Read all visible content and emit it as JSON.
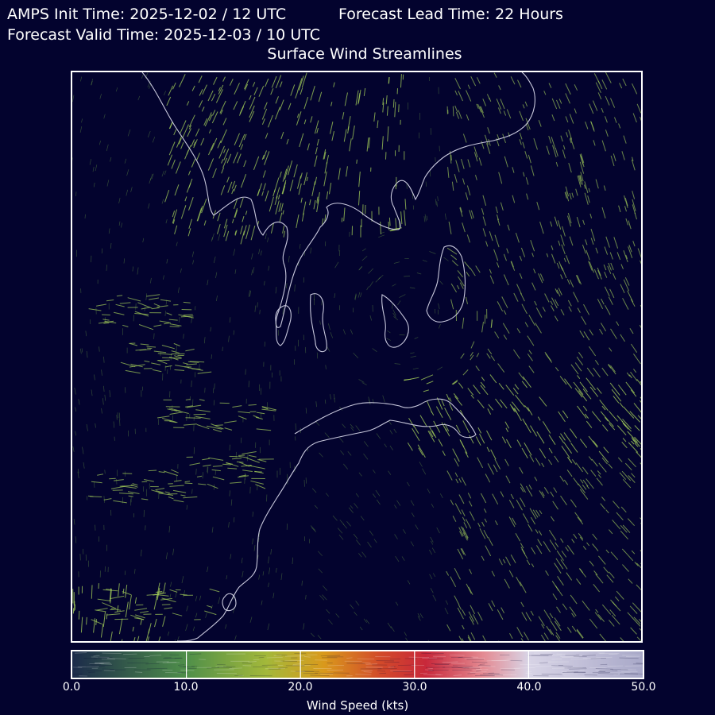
{
  "header": {
    "init_time": "AMPS Init Time: 2025-12-02 / 12 UTC",
    "lead_time": "Forecast Lead Time: 22 Hours",
    "valid_time": "Forecast Valid Time: 2025-12-03 / 10 UTC",
    "subtitle": "Surface Wind Streamlines"
  },
  "colors": {
    "background": "#03032e",
    "coastline": "#c8c8dc",
    "frame": "#ffffff",
    "streamline_low": "#7dbd4a",
    "streamline_high": "#a6d25a"
  },
  "colorbar": {
    "label": "Wind Speed (kts)",
    "min": 0,
    "max": 50,
    "ticks": [
      "0.0",
      "10.0",
      "20.0",
      "30.0",
      "40.0",
      "50.0"
    ],
    "tick_values": [
      0,
      10,
      20,
      30,
      40,
      50
    ],
    "stops": [
      {
        "value": 0,
        "color": "#1b2a4a"
      },
      {
        "value": 10,
        "color": "#4f8f4a"
      },
      {
        "value": 17,
        "color": "#a3b83a"
      },
      {
        "value": 22,
        "color": "#d99a1c"
      },
      {
        "value": 27,
        "color": "#d24a2a"
      },
      {
        "value": 31,
        "color": "#c8283a"
      },
      {
        "value": 36,
        "color": "#e48a92"
      },
      {
        "value": 40,
        "color": "#d8d4e6"
      },
      {
        "value": 50,
        "color": "#a8a8c8"
      }
    ]
  }
}
